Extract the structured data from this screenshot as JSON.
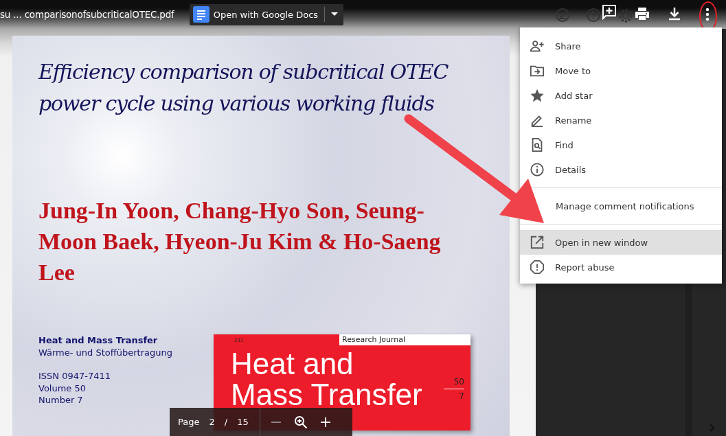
{
  "top_bar": {
    "file_name": "su ... comparisonofsubcriticalOTEC.pdf",
    "open_with": {
      "label": "Open with Google Docs"
    },
    "icons": [
      {
        "kind": "check",
        "dimmed": true
      },
      {
        "kind": "help",
        "dimmed": true
      },
      {
        "kind": "comment",
        "dimmed": false
      },
      {
        "kind": "gear",
        "dimmed": true
      },
      {
        "kind": "print",
        "dimmed": false
      },
      {
        "kind": "download",
        "dimmed": false
      },
      {
        "kind": "more",
        "dimmed": false
      }
    ]
  },
  "document": {
    "title": "Efficiency comparison of subcritical OTEC power cycle using various working fluids",
    "authors": "Jung-In Yoon, Chang-Hyo Son, Seung-Moon Baek, Hyeon-Ju Kim & Ho-Saeng Lee",
    "journal": "Heat and Mass Transfer",
    "journal_subtitle": "Wärme- und Stoffübertragung",
    "issn": "ISSN 0947-7411",
    "volume": "Volume 50",
    "number": "Number 7",
    "cover": {
      "page_number": "231",
      "label": "Research Journal",
      "title_lines": [
        "Heat and",
        "Mass Transfer"
      ],
      "volume": "50",
      "number": "7"
    }
  },
  "page_toolbar": {
    "label": "Page",
    "current": "2",
    "separator": "/",
    "total": "15"
  },
  "menu": {
    "groups": [
      [
        {
          "kind": "share",
          "label": "Share",
          "selected": false
        },
        {
          "kind": "move",
          "label": "Move to",
          "selected": false
        },
        {
          "kind": "star",
          "label": "Add star",
          "selected": false
        },
        {
          "kind": "rename",
          "label": "Rename",
          "selected": false
        },
        {
          "kind": "find",
          "label": "Find",
          "selected": false
        },
        {
          "kind": "details",
          "label": "Details",
          "selected": false
        }
      ],
      [
        {
          "label": "Manage comment notifications",
          "selected": false
        }
      ],
      [
        {
          "kind": "open",
          "label": "Open in new window",
          "selected": true
        },
        {
          "kind": "report",
          "label": "Report abuse",
          "selected": false
        }
      ]
    ]
  }
}
